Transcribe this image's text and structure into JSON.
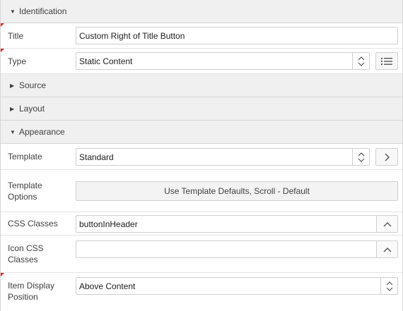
{
  "sections": {
    "identification": "Identification",
    "source": "Source",
    "layout": "Layout",
    "appearance": "Appearance"
  },
  "fields": {
    "title": {
      "label": "Title",
      "value": "Custom Right of Title Button"
    },
    "type": {
      "label": "Type",
      "value": "Static Content"
    },
    "template": {
      "label": "Template",
      "value": "Standard"
    },
    "template_options": {
      "label_line1": "Template",
      "label_line2": "Options",
      "button": "Use Template Defaults, Scroll - Default"
    },
    "css_classes": {
      "label": "CSS Classes",
      "value": "buttonInHeader"
    },
    "icon_css_classes": {
      "label_line1": "Icon CSS",
      "label_line2": "Classes",
      "value": ""
    },
    "item_display_position": {
      "label_line1": "Item Display",
      "label_line2": "Position",
      "value": "Above Content"
    }
  },
  "colors": {
    "required_marker": "#e0202a",
    "section_bg": "#f0f0f0"
  },
  "icons": {
    "collapse": "triangle-down-icon",
    "expand": "triangle-right-icon",
    "select": "up-down-chevron-icon",
    "list": "list-icon",
    "go": "chevron-right-icon",
    "popup": "chevron-up-icon"
  }
}
